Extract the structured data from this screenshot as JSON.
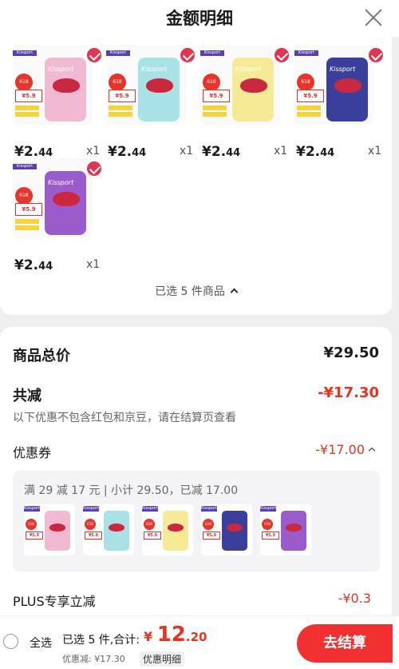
{
  "header": {
    "title": "金额明细"
  },
  "products": {
    "items": [
      {
        "brand": "Kissport",
        "badge": "618",
        "sticker": "¥5.9",
        "price_main": "¥2.",
        "price_small": "44",
        "qty": "x1",
        "color": "#f2b9d3",
        "accent": "#e58bb6"
      },
      {
        "brand": "Kissport",
        "badge": "618",
        "sticker": "¥5.9",
        "price_main": "¥2.",
        "price_small": "44",
        "qty": "x1",
        "color": "#a9e2e6",
        "accent": "#6fcad3"
      },
      {
        "brand": "Kissport",
        "badge": "618",
        "sticker": "¥5.9",
        "price_main": "¥2.",
        "price_small": "44",
        "qty": "x1",
        "color": "#f7ea96",
        "accent": "#eed35f"
      },
      {
        "brand": "Kissport",
        "badge": "618",
        "sticker": "¥5.9",
        "price_main": "¥2.",
        "price_small": "44",
        "qty": "x1",
        "color": "#3b3f9c",
        "accent": "#2a2d7e"
      },
      {
        "brand": "Kissport",
        "badge": "618",
        "sticker": "¥5.9",
        "price_main": "¥2.",
        "price_small": "44",
        "qty": "x1",
        "color": "#9a5ccc",
        "accent": "#7b3eb4"
      }
    ],
    "selected_text": "已选 5 件商品"
  },
  "summary": {
    "total_label": "商品总价",
    "total_value": "¥29.50",
    "discount_label": "共减",
    "discount_value": "-¥17.30",
    "note": "以下优惠不包含红包和京豆，请在结算页查看",
    "coupon_label": "优惠券",
    "coupon_value": "-¥17.00",
    "coupon_info": "满 29 减 17 元 | 小计 29.50，已减 17.00",
    "plus_label": "PLUS专享立减",
    "plus_value": "-¥0.3"
  },
  "bottom": {
    "select_all": "全选",
    "selected_count": "已选 5 件,合计:",
    "total_currency": "¥",
    "total_int": "12",
    "total_dec": ".20",
    "saved": "优惠减: ¥17.30",
    "detail": "优惠明细",
    "checkout": "去结算"
  },
  "colors": {
    "accent_red": "#e5341f",
    "check_red": "#e0364f"
  }
}
